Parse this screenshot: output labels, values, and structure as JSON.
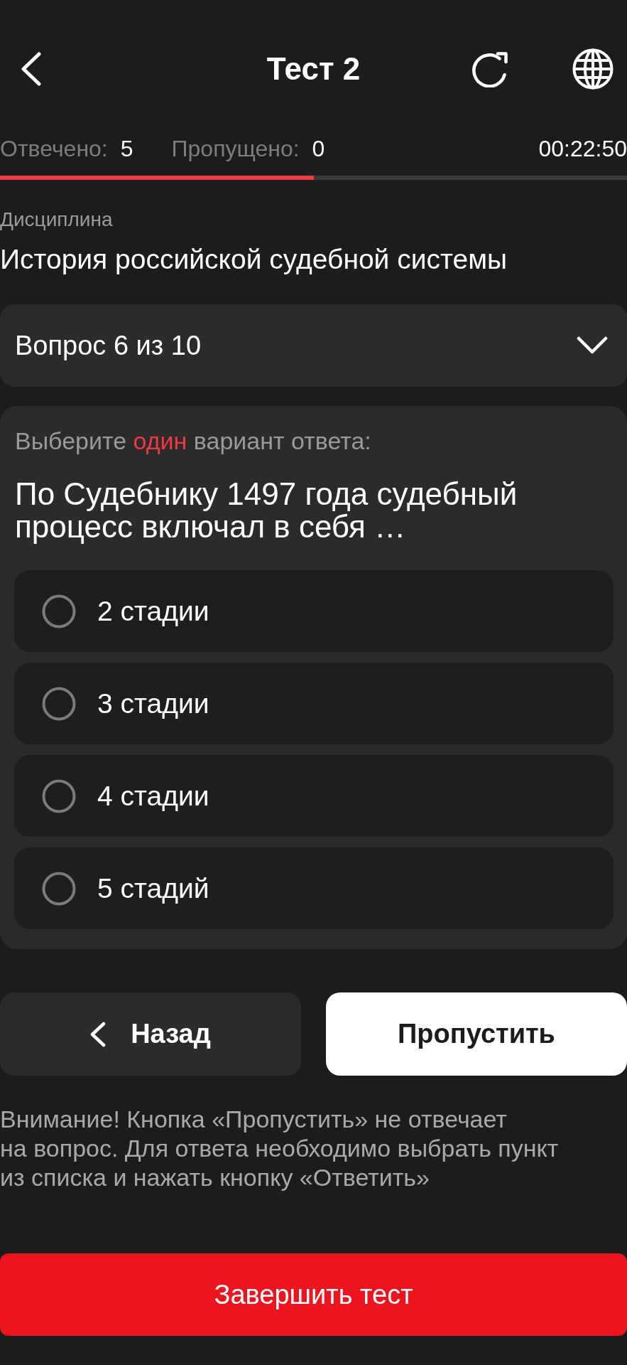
{
  "header": {
    "title": "Тест 2"
  },
  "counters": [
    {
      "label": "Отвечено:",
      "value": "5"
    },
    {
      "label": "Пропущено:",
      "value": "0"
    }
  ],
  "timer": "00:22:50",
  "progress": {
    "level": 0.5
  },
  "discipline": {
    "label": "Дисциплина",
    "value": "История российской судебной системы"
  },
  "question_selector": {
    "label": "Вопрос 6 из 10",
    "expanded": false
  },
  "question": {
    "instruction": "Выберите **один** вариант ответа:",
    "text": "По Судебнику 1497 года судебный процесс включал в себя …"
  },
  "options": [
    {
      "label": "2 стадии",
      "selected": false
    },
    {
      "label": "3 стадии",
      "selected": false
    },
    {
      "label": "4 стадии",
      "selected": false
    },
    {
      "label": "5 стадий",
      "selected": false
    }
  ],
  "buttons": [
    {
      "kind": "back",
      "label": "Назад"
    },
    {
      "kind": "skip",
      "label": "Пропустить"
    }
  ],
  "notice": "Внимание! Кнопка «Пропустить» не отвечает\nна вопрос. Для ответа необходимо выбрать пункт\nиз списка и нажать кнопку «Ответить»",
  "finish_button": {
    "label": "Завершить тест"
  }
}
